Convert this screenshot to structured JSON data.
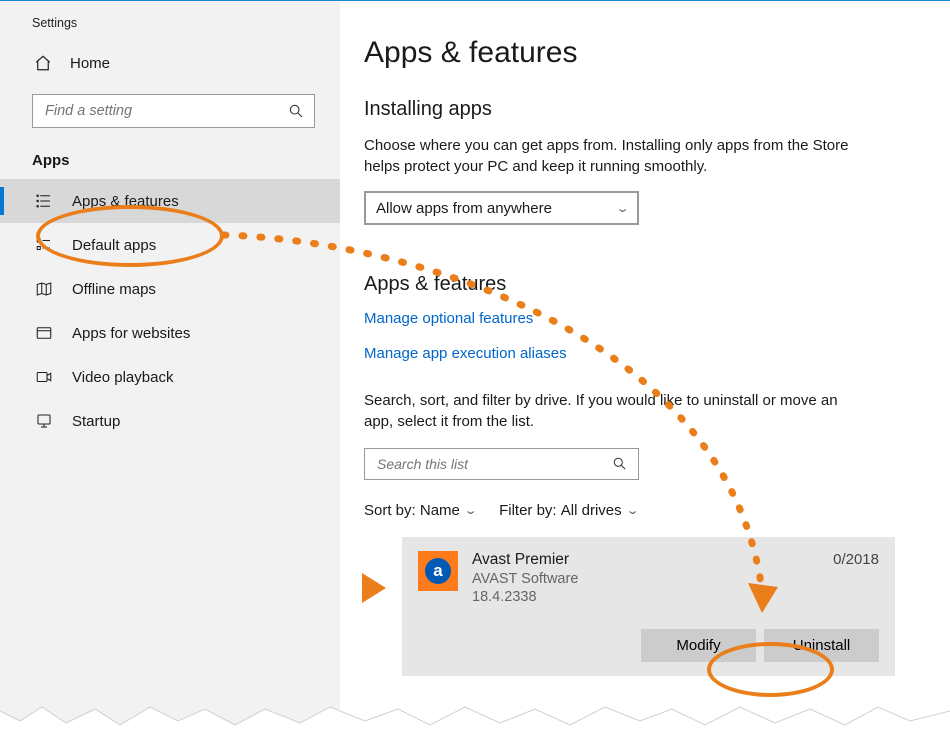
{
  "window": {
    "title": "Settings"
  },
  "sidebar": {
    "home": "Home",
    "search_placeholder": "Find a setting",
    "section": "Apps",
    "items": [
      {
        "label": "Apps & features",
        "active": true
      },
      {
        "label": "Default apps"
      },
      {
        "label": "Offline maps"
      },
      {
        "label": "Apps for websites"
      },
      {
        "label": "Video playback"
      },
      {
        "label": "Startup"
      }
    ]
  },
  "main": {
    "title": "Apps & features",
    "installing": {
      "heading": "Installing apps",
      "desc": "Choose where you can get apps from. Installing only apps from the Store helps protect your PC and keep it running smoothly.",
      "dropdown": "Allow apps from anywhere"
    },
    "apps_section": {
      "heading": "Apps & features",
      "link1": "Manage optional features",
      "link2": "Manage app execution aliases",
      "search_desc": "Search, sort, and filter by drive. If you would like to uninstall or move an app, select it from the list.",
      "search_placeholder": "Search this list",
      "sort_label": "Sort by:",
      "sort_value": "Name",
      "filter_label": "Filter by:",
      "filter_value": "All drives"
    },
    "app": {
      "name": "Avast Premier",
      "publisher": "AVAST Software",
      "version": "18.4.2338",
      "date_fragment": "0/2018",
      "modify": "Modify",
      "uninstall": "Uninstall"
    }
  },
  "colors": {
    "annotation": "#ea7e1a",
    "link": "#0066cc",
    "accent": "#0078d4"
  }
}
